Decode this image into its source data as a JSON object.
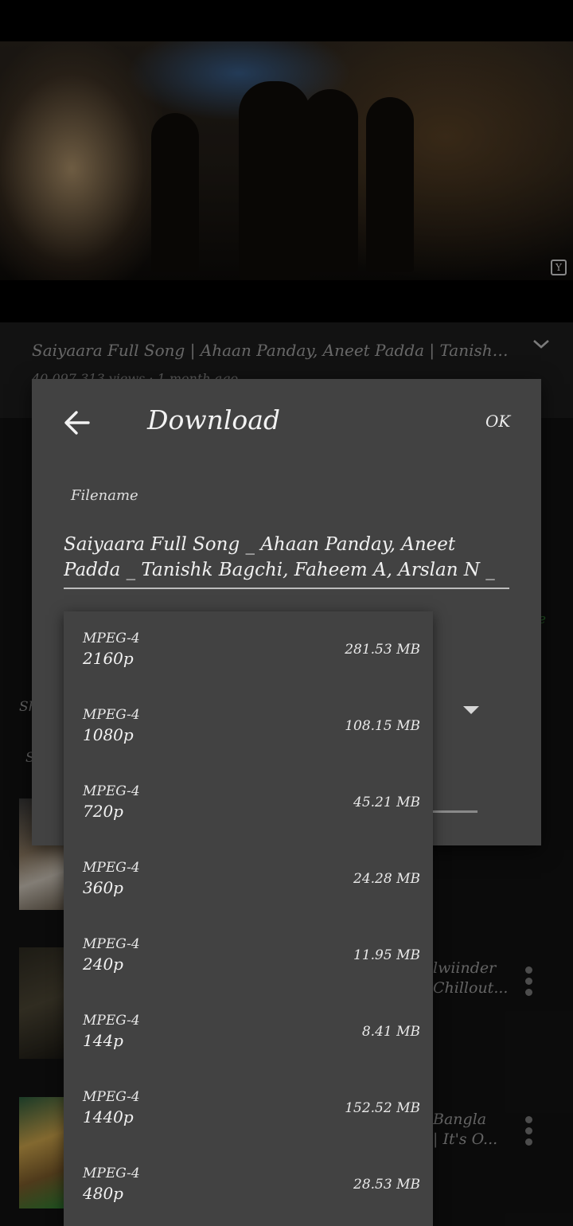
{
  "video": {
    "title": "Saiyaara Full Song | Ahaan Panday, Aneet Padda | Tanishk Ba...",
    "meta": "40,097,313 views · 1 month ago"
  },
  "background_list": {
    "row1_line1": "lwiinder",
    "row1_line2": "Chillout...",
    "row2_line1": "Bangla",
    "row2_line2": "| It's O...",
    "side_char_1": "Sh",
    "side_char_2": "S",
    "side_char_3": "e"
  },
  "dialog": {
    "title": "Download",
    "ok_label": "OK",
    "back_icon": "arrow-left-icon",
    "filename_label": "Filename",
    "filename_value": "Saiyaara Full Song _ Ahaan Panday, Aneet Padda _ Tanishk Bagchi, Faheem A, Arslan N _"
  },
  "formats": [
    {
      "format": "MPEG-4",
      "resolution": "2160p",
      "size": "281.53 MB"
    },
    {
      "format": "MPEG-4",
      "resolution": "1080p",
      "size": "108.15 MB"
    },
    {
      "format": "MPEG-4",
      "resolution": "720p",
      "size": "45.21 MB"
    },
    {
      "format": "MPEG-4",
      "resolution": "360p",
      "size": "24.28 MB"
    },
    {
      "format": "MPEG-4",
      "resolution": "240p",
      "size": "11.95 MB"
    },
    {
      "format": "MPEG-4",
      "resolution": "144p",
      "size": "8.41 MB"
    },
    {
      "format": "MPEG-4",
      "resolution": "1440p",
      "size": "152.52 MB"
    },
    {
      "format": "MPEG-4",
      "resolution": "480p",
      "size": "28.53 MB"
    }
  ],
  "colors": {
    "dialog_bg": "#424242",
    "accent_green": "#2e7d32"
  }
}
